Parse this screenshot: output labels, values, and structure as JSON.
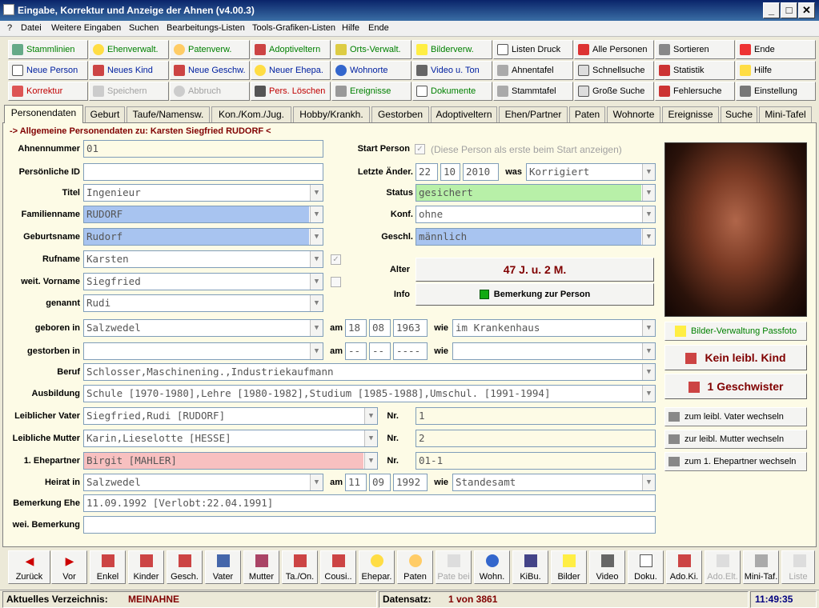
{
  "window": {
    "title": "Eingabe, Korrektur und Anzeige der Ahnen (v4.00.3)"
  },
  "menu": [
    "?",
    "Datei",
    "Weitere Eingaben",
    "Suchen",
    "Bearbeitungs-Listen",
    "Tools-Grafiken-Listen",
    "Hilfe",
    "Ende"
  ],
  "toolbar": {
    "row1": [
      "Stammlinien",
      "Ehenverwalt.",
      "Patenverw.",
      "Adoptiveltern",
      "Orts-Verwalt.",
      "Bilderverw.",
      "Listen Druck",
      "Alle Personen",
      "Sortieren",
      "Ende"
    ],
    "row2": [
      "Neue Person",
      "Neues Kind",
      "Neue Geschw.",
      "Neuer Ehepa.",
      "Wohnorte",
      "Video u. Ton",
      "Ahnentafel",
      "Schnellsuche",
      "Statistik",
      "Hilfe"
    ],
    "row3": [
      "Korrektur",
      "Speichern",
      "Abbruch",
      "Pers. Löschen",
      "Ereignisse",
      "Dokumente",
      "Stammtafel",
      "Große Suche",
      "Fehlersuche",
      "Einstellung"
    ]
  },
  "tabs": [
    "Personendaten",
    "Geburt",
    "Taufe/Namensw.",
    "Kon./Kom./Jug.",
    "Hobby/Krankh.",
    "Gestorben",
    "Adoptiveltern",
    "Ehen/Partner",
    "Paten",
    "Wohnorte",
    "Ereignisse",
    "Suche",
    "Mini-Tafel"
  ],
  "section_title": "-> Allgemeine Personendaten zu:  Karsten Siegfried RUDORF <",
  "labels": {
    "ahnennummer": "Ahnennummer",
    "pid": "Persönliche ID",
    "titel": "Titel",
    "familienname": "Familienname",
    "geburtsname": "Geburtsname",
    "rufname": "Rufname",
    "weitvorname": "weit. Vorname",
    "genannt": "genannt",
    "geboren": "geboren in",
    "gestorben": "gestorben in",
    "beruf": "Beruf",
    "ausbildung": "Ausbildung",
    "vater": "Leiblicher Vater",
    "mutter": "Leibliche Mutter",
    "ehepartner": "1. Ehepartner",
    "heirat": "Heirat in",
    "bemehe": "Bemerkung Ehe",
    "weibem": "wei. Bemerkung",
    "startperson": "Start Person",
    "letzteaender": "Letzte Änder.",
    "was": "was",
    "status": "Status",
    "konf": "Konf.",
    "geschl": "Geschl.",
    "alter": "Alter",
    "info": "Info",
    "am": "am",
    "wie": "wie",
    "nr": "Nr."
  },
  "values": {
    "ahnennummer": "01",
    "pid": "",
    "titel": "Ingenieur",
    "familienname": "RUDORF",
    "geburtsname": "Rudorf",
    "rufname": "Karsten",
    "weitvorname": "Siegfried",
    "genannt": "Rudi",
    "geboren_ort": "Salzwedel",
    "geb_tag": "18",
    "geb_mon": "08",
    "geb_jahr": "1963",
    "geb_wie": "im Krankenhaus",
    "gest_ort": "",
    "gest_tag": "--",
    "gest_mon": "--",
    "gest_jahr": "----",
    "gest_wie": "",
    "beruf": "Schlosser,Maschinening.,Industriekaufmann",
    "ausbildung": "Schule [1970-1980],Lehre [1980-1982],Studium [1985-1988],Umschul. [1991-1994]",
    "vater": "Siegfried,Rudi [RUDORF]",
    "vater_nr": "1",
    "mutter": "Karin,Lieselotte [HESSE]",
    "mutter_nr": "2",
    "ehepartner": "Birgit [MAHLER]",
    "ehepartner_nr": "01-1",
    "heirat_ort": "Salzwedel",
    "heirat_tag": "11",
    "heirat_mon": "09",
    "heirat_jahr": "1992",
    "heirat_wie": "Standesamt",
    "bemehe": "11.09.1992 [Verlobt:22.04.1991]",
    "weibem": "",
    "startperson_text": "(Diese Person als erste beim Start anzeigen)",
    "aend_tag": "22",
    "aend_mon": "10",
    "aend_jahr": "2010",
    "was": "Korrigiert",
    "status": "gesichert",
    "konf": "ohne",
    "geschl": "männlich",
    "alter": "47 J. u. 2 M.",
    "info": "Bemerkung zur Person"
  },
  "side": {
    "photo_alt": "Passfoto",
    "bilder": "Bilder-Verwaltung Passfoto",
    "kind": "Kein leibl. Kind",
    "geschwister": "1 Geschwister",
    "vater_btn": "zum leibl. Vater wechseln",
    "mutter_btn": "zur leibl. Mutter wechseln",
    "partner_btn": "zum 1. Ehepartner wechseln"
  },
  "bottom": [
    "Zurück",
    "Vor",
    "Enkel",
    "Kinder",
    "Gesch.",
    "Vater",
    "Mutter",
    "Ta./On.",
    "Cousi..",
    "Ehepar.",
    "Paten",
    "Pate bei",
    "Wohn.",
    "KiBu.",
    "Bilder",
    "Video",
    "Doku.",
    "Ado.Ki.",
    "Ado.Elt.",
    "Mini-Taf.",
    "Liste"
  ],
  "status": {
    "verz_label": "Aktuelles Verzeichnis:",
    "verz": "MEINAHNE",
    "ds_label": "Datensatz:",
    "ds": "1 von 3861",
    "time": "11:49:35"
  },
  "colors": {
    "blue_field": "#a8c4f0",
    "green_field": "#b8f0a8",
    "pink_field": "#f8c0c0",
    "panel": "#fdfbe6",
    "maroon": "#800000"
  }
}
